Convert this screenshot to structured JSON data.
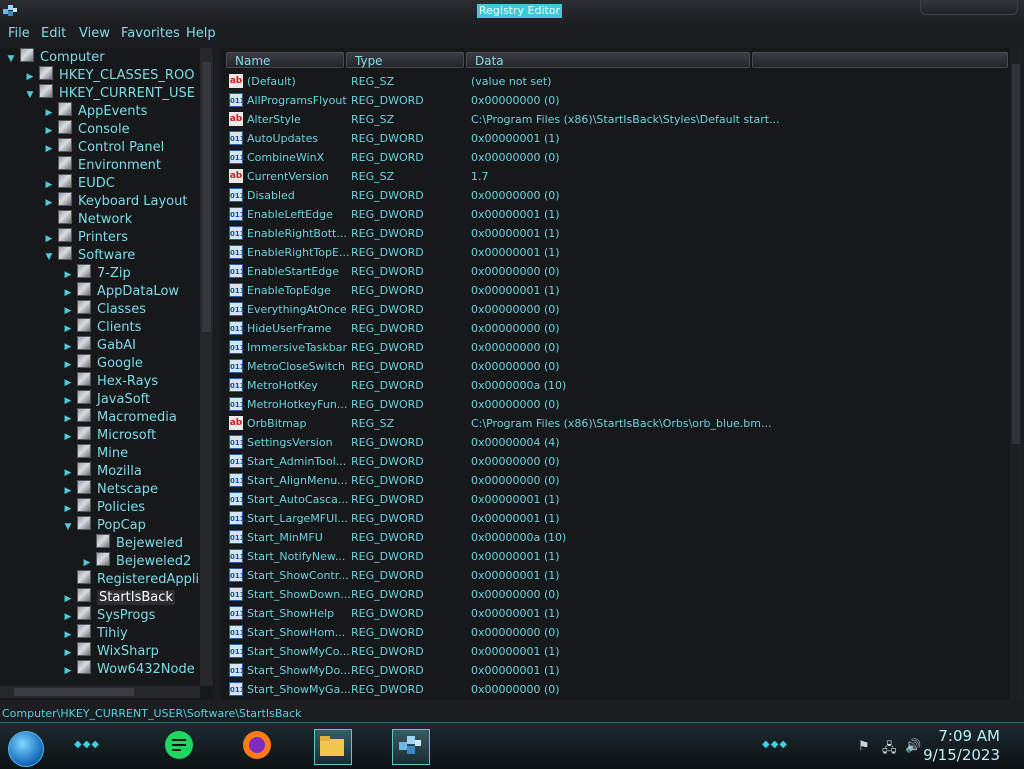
{
  "window": {
    "title": "Registry Editor"
  },
  "menu": [
    "File",
    "Edit",
    "View",
    "Favorites",
    "Help"
  ],
  "tree": [
    {
      "label": "Computer",
      "level": 0,
      "expander": "open"
    },
    {
      "label": "HKEY_CLASSES_ROO",
      "level": 1,
      "expander": "closed"
    },
    {
      "label": "HKEY_CURRENT_USE",
      "level": 1,
      "expander": "open"
    },
    {
      "label": "AppEvents",
      "level": 2,
      "expander": "closed"
    },
    {
      "label": "Console",
      "level": 2,
      "expander": "closed"
    },
    {
      "label": "Control Panel",
      "level": 2,
      "expander": "closed"
    },
    {
      "label": "Environment",
      "level": 2,
      "expander": "none"
    },
    {
      "label": "EUDC",
      "level": 2,
      "expander": "closed"
    },
    {
      "label": "Keyboard Layout",
      "level": 2,
      "expander": "closed"
    },
    {
      "label": "Network",
      "level": 2,
      "expander": "none"
    },
    {
      "label": "Printers",
      "level": 2,
      "expander": "closed"
    },
    {
      "label": "Software",
      "level": 2,
      "expander": "open"
    },
    {
      "label": "7-Zip",
      "level": 3,
      "expander": "closed"
    },
    {
      "label": "AppDataLow",
      "level": 3,
      "expander": "closed"
    },
    {
      "label": "Classes",
      "level": 3,
      "expander": "closed"
    },
    {
      "label": "Clients",
      "level": 3,
      "expander": "closed"
    },
    {
      "label": "GabAI",
      "level": 3,
      "expander": "closed"
    },
    {
      "label": "Google",
      "level": 3,
      "expander": "closed"
    },
    {
      "label": "Hex-Rays",
      "level": 3,
      "expander": "closed"
    },
    {
      "label": "JavaSoft",
      "level": 3,
      "expander": "closed"
    },
    {
      "label": "Macromedia",
      "level": 3,
      "expander": "closed"
    },
    {
      "label": "Microsoft",
      "level": 3,
      "expander": "closed"
    },
    {
      "label": "Mine",
      "level": 3,
      "expander": "none"
    },
    {
      "label": "Mozilla",
      "level": 3,
      "expander": "closed"
    },
    {
      "label": "Netscape",
      "level": 3,
      "expander": "closed"
    },
    {
      "label": "Policies",
      "level": 3,
      "expander": "closed"
    },
    {
      "label": "PopCap",
      "level": 3,
      "expander": "open"
    },
    {
      "label": "Bejeweled",
      "level": 4,
      "expander": "none"
    },
    {
      "label": "Bejeweled2",
      "level": 4,
      "expander": "closed"
    },
    {
      "label": "RegisteredApplic",
      "level": 3,
      "expander": "none"
    },
    {
      "label": "StartIsBack",
      "level": 3,
      "expander": "closed",
      "selected": true
    },
    {
      "label": "SysProgs",
      "level": 3,
      "expander": "closed"
    },
    {
      "label": "Tihiy",
      "level": 3,
      "expander": "closed"
    },
    {
      "label": "WixSharp",
      "level": 3,
      "expander": "closed"
    },
    {
      "label": "Wow6432Node",
      "level": 3,
      "expander": "closed"
    }
  ],
  "columns": [
    "Name",
    "Type",
    "Data"
  ],
  "values": [
    {
      "name": "(Default)",
      "type": "REG_SZ",
      "data": "(value not set)"
    },
    {
      "name": "AllProgramsFlyout",
      "type": "REG_DWORD",
      "data": "0x00000000 (0)"
    },
    {
      "name": "AlterStyle",
      "type": "REG_SZ",
      "data": "C:\\Program Files (x86)\\StartIsBack\\Styles\\Default start..."
    },
    {
      "name": "AutoUpdates",
      "type": "REG_DWORD",
      "data": "0x00000001 (1)"
    },
    {
      "name": "CombineWinX",
      "type": "REG_DWORD",
      "data": "0x00000000 (0)"
    },
    {
      "name": "CurrentVersion",
      "type": "REG_SZ",
      "data": "1.7"
    },
    {
      "name": "Disabled",
      "type": "REG_DWORD",
      "data": "0x00000000 (0)"
    },
    {
      "name": "EnableLeftEdge",
      "type": "REG_DWORD",
      "data": "0x00000001 (1)"
    },
    {
      "name": "EnableRightBott...",
      "type": "REG_DWORD",
      "data": "0x00000001 (1)"
    },
    {
      "name": "EnableRightTopE...",
      "type": "REG_DWORD",
      "data": "0x00000001 (1)"
    },
    {
      "name": "EnableStartEdge",
      "type": "REG_DWORD",
      "data": "0x00000000 (0)"
    },
    {
      "name": "EnableTopEdge",
      "type": "REG_DWORD",
      "data": "0x00000001 (1)"
    },
    {
      "name": "EverythingAtOnce",
      "type": "REG_DWORD",
      "data": "0x00000000 (0)"
    },
    {
      "name": "HideUserFrame",
      "type": "REG_DWORD",
      "data": "0x00000000 (0)"
    },
    {
      "name": "ImmersiveTaskbar",
      "type": "REG_DWORD",
      "data": "0x00000000 (0)"
    },
    {
      "name": "MetroCloseSwitch",
      "type": "REG_DWORD",
      "data": "0x00000000 (0)"
    },
    {
      "name": "MetroHotKey",
      "type": "REG_DWORD",
      "data": "0x0000000a (10)"
    },
    {
      "name": "MetroHotkeyFun...",
      "type": "REG_DWORD",
      "data": "0x00000000 (0)"
    },
    {
      "name": "OrbBitmap",
      "type": "REG_SZ",
      "data": "C:\\Program Files (x86)\\StartIsBack\\Orbs\\orb_blue.bm..."
    },
    {
      "name": "SettingsVersion",
      "type": "REG_DWORD",
      "data": "0x00000004 (4)"
    },
    {
      "name": "Start_AdminTool...",
      "type": "REG_DWORD",
      "data": "0x00000000 (0)"
    },
    {
      "name": "Start_AlignMenu...",
      "type": "REG_DWORD",
      "data": "0x00000000 (0)"
    },
    {
      "name": "Start_AutoCasca...",
      "type": "REG_DWORD",
      "data": "0x00000001 (1)"
    },
    {
      "name": "Start_LargeMFUI...",
      "type": "REG_DWORD",
      "data": "0x00000001 (1)"
    },
    {
      "name": "Start_MinMFU",
      "type": "REG_DWORD",
      "data": "0x0000000a (10)"
    },
    {
      "name": "Start_NotifyNew...",
      "type": "REG_DWORD",
      "data": "0x00000001 (1)"
    },
    {
      "name": "Start_ShowContr...",
      "type": "REG_DWORD",
      "data": "0x00000001 (1)"
    },
    {
      "name": "Start_ShowDown...",
      "type": "REG_DWORD",
      "data": "0x00000000 (0)"
    },
    {
      "name": "Start_ShowHelp",
      "type": "REG_DWORD",
      "data": "0x00000001 (1)"
    },
    {
      "name": "Start_ShowHom...",
      "type": "REG_DWORD",
      "data": "0x00000000 (0)"
    },
    {
      "name": "Start_ShowMyCo...",
      "type": "REG_DWORD",
      "data": "0x00000001 (1)"
    },
    {
      "name": "Start_ShowMyDo...",
      "type": "REG_DWORD",
      "data": "0x00000001 (1)"
    },
    {
      "name": "Start_ShowMyGa...",
      "type": "REG_DWORD",
      "data": "0x00000000 (0)"
    }
  ],
  "status": "Computer\\HKEY_CURRENT_USER\\Software\\StartIsBack",
  "taskbar": {
    "time": "7:09 AM",
    "date": "9/15/2023",
    "apps": [
      {
        "name": "notes-app-icon",
        "color": "#1ed760"
      },
      {
        "name": "firefox-icon",
        "color": "#ff7a18"
      },
      {
        "name": "file-explorer-icon",
        "color": "#f1c84b"
      },
      {
        "name": "registry-editor-icon",
        "color": "#4aa3df"
      }
    ]
  },
  "colors": {
    "accent": "#41c8d8",
    "text": "#6fd3e0",
    "background": "#16181a"
  }
}
